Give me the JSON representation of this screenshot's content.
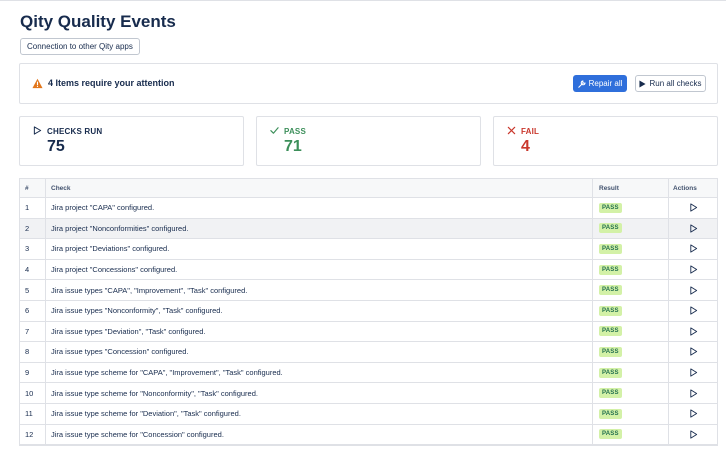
{
  "page": {
    "title": "Qity Quality Events"
  },
  "connection_button": {
    "label": "Connection to other Qity apps"
  },
  "attention": {
    "text": "4 Items require your attention",
    "repair_label": "Repair all",
    "run_label": "Run all checks"
  },
  "cards": [
    {
      "label": "CHECKS RUN",
      "value": "75",
      "color": "#172b4d",
      "icon": "play-outline-icon"
    },
    {
      "label": "PASS",
      "value": "71",
      "color": "#3c8f5a",
      "icon": "check-icon"
    },
    {
      "label": "FAIL",
      "value": "4",
      "color": "#c9372c",
      "icon": "x-icon"
    }
  ],
  "table": {
    "headers": {
      "num": "#",
      "check": "Check",
      "result": "Result",
      "actions": "Actions"
    },
    "rows": [
      {
        "num": "1",
        "check": "Jira project \"CAPA\" configured.",
        "result": "PASS"
      },
      {
        "num": "2",
        "check": "Jira project \"Nonconformities\" configured.",
        "result": "PASS"
      },
      {
        "num": "3",
        "check": "Jira project \"Deviations\" configured.",
        "result": "PASS"
      },
      {
        "num": "4",
        "check": "Jira project \"Concessions\" configured.",
        "result": "PASS"
      },
      {
        "num": "5",
        "check": "Jira issue types \"CAPA\", \"Improvement\", \"Task\" configured.",
        "result": "PASS"
      },
      {
        "num": "6",
        "check": "Jira issue types \"Nonconformity\", \"Task\" configured.",
        "result": "PASS"
      },
      {
        "num": "7",
        "check": "Jira issue types \"Deviation\", \"Task\" configured.",
        "result": "PASS"
      },
      {
        "num": "8",
        "check": "Jira issue types \"Concession\" configured.",
        "result": "PASS"
      },
      {
        "num": "9",
        "check": "Jira issue type scheme for \"CAPA\", \"Improvement\", \"Task\" configured.",
        "result": "PASS"
      },
      {
        "num": "10",
        "check": "Jira issue type scheme for \"Nonconformity\", \"Task\" configured.",
        "result": "PASS"
      },
      {
        "num": "11",
        "check": "Jira issue type scheme for \"Deviation\", \"Task\" configured.",
        "result": "PASS"
      },
      {
        "num": "12",
        "check": "Jira issue type scheme for \"Concession\" configured.",
        "result": "PASS"
      }
    ]
  },
  "colors": {
    "accent": "#2f6fdb",
    "pass_badge": "#d3f1a7",
    "warning": "#e2761b"
  }
}
